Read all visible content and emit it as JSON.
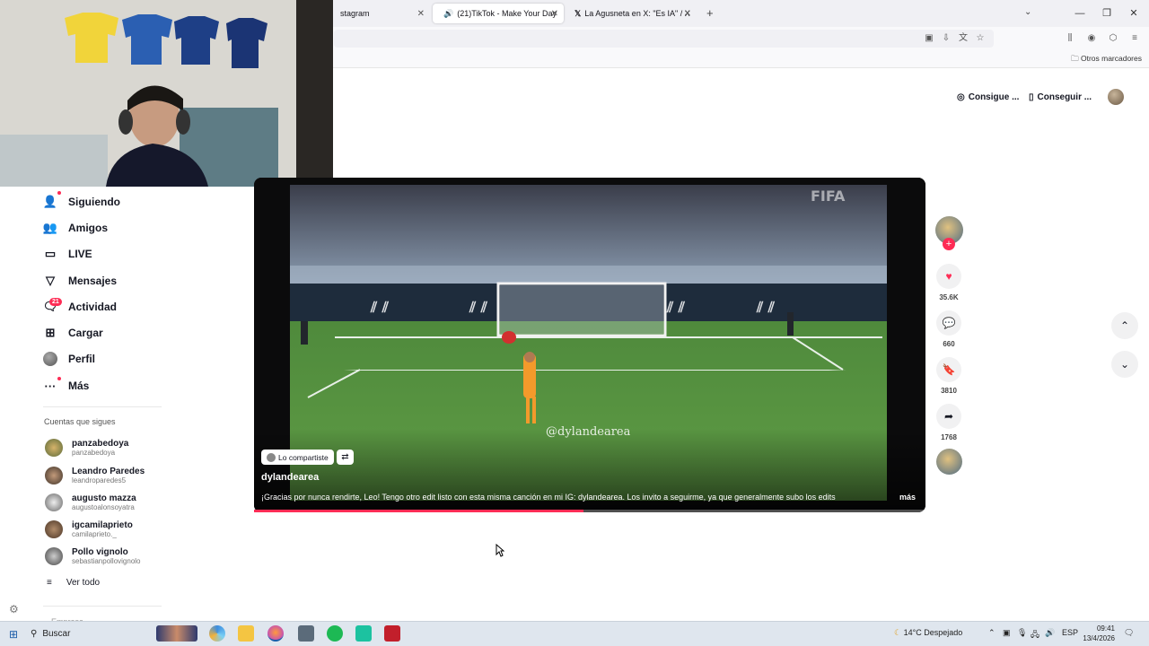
{
  "browser": {
    "tabs": [
      {
        "label": "stagram"
      },
      {
        "label": "(21)TikTok - Make Your Day"
      },
      {
        "label": "La Agusneta en X: \"Es IA\" / X"
      }
    ],
    "bookmarks_other": "Otros marcadores"
  },
  "header": {
    "pill1": "Consigue ...",
    "pill2": "Conseguir ..."
  },
  "sidebar": {
    "items": [
      {
        "label": "Siguiendo",
        "icon": "following-icon"
      },
      {
        "label": "Amigos",
        "icon": "friends-icon"
      },
      {
        "label": "LIVE",
        "icon": "live-icon"
      },
      {
        "label": "Mensajes",
        "icon": "messages-icon"
      },
      {
        "label": "Actividad",
        "icon": "activity-icon",
        "badge": "21"
      },
      {
        "label": "Cargar",
        "icon": "upload-icon"
      },
      {
        "label": "Perfil",
        "icon": "profile-avatar"
      },
      {
        "label": "Más",
        "icon": "more-icon"
      }
    ],
    "following_title": "Cuentas que sigues",
    "accounts": [
      {
        "name": "panzabedoya",
        "handle": "panzabedoya"
      },
      {
        "name": "Leandro Paredes",
        "handle": "leandroparedes5"
      },
      {
        "name": "augusto mazza",
        "handle": "augustoalonsoyatra"
      },
      {
        "name": "igcamilaprieto",
        "handle": "camilaprieto._"
      },
      {
        "name": "Pollo vignolo",
        "handle": "sebastianpollovignolo"
      }
    ],
    "see_all": "Ver todo",
    "company": "Empresa"
  },
  "video": {
    "chip": "Lo compartiste",
    "author": "dylandearea",
    "description": "¡Gracias por nunca rendirte, Leo! Tengo otro edit listo con esta misma canción en mi IG: dylandearea. Los invito a seguirme, ya que generalmente subo los edits",
    "more": "más",
    "watermark": "@dylandearea",
    "board_text": "FIFA",
    "progress": 0.49
  },
  "actions": {
    "likes": "35.6K",
    "comments": "660",
    "saves": "3810",
    "shares": "1768"
  },
  "taskbar": {
    "search": "Buscar",
    "weather": "14°C  Despejado",
    "lang": "ESP",
    "time": "09:41",
    "date": "13/4/2026"
  },
  "colors": {
    "accent": "#fe2c55",
    "pitch": "#4f8a3c",
    "orange_kit": "#f39a2b"
  }
}
